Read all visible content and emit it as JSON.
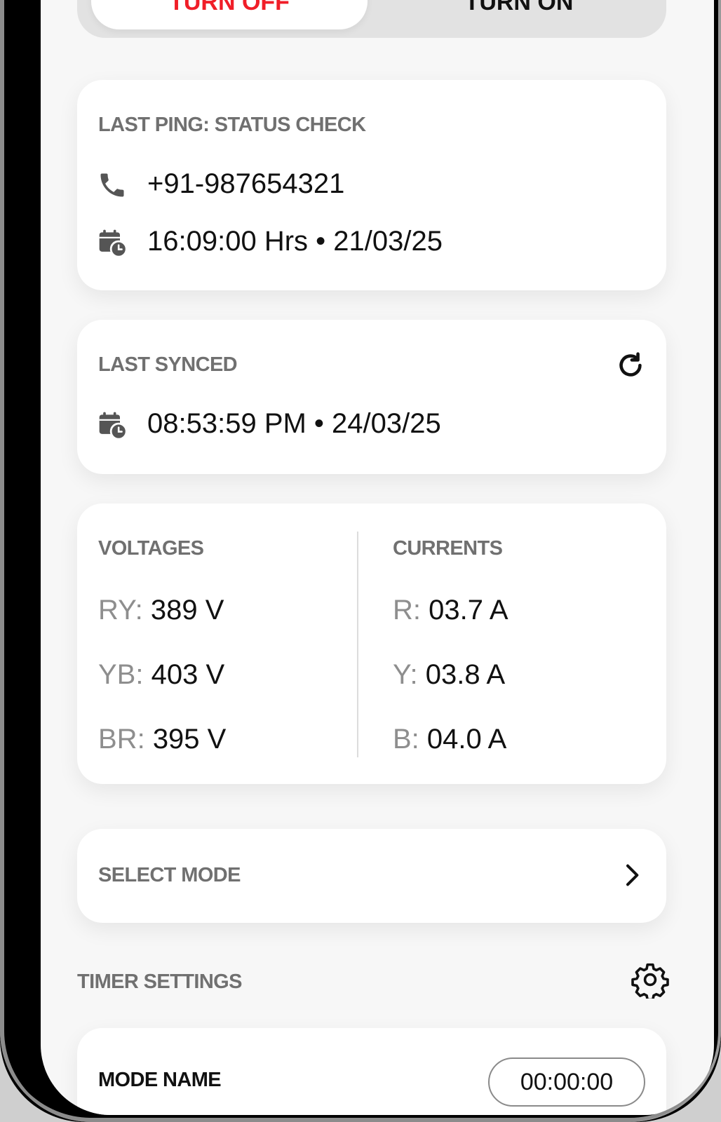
{
  "toggle": {
    "off_label": "TURN OFF",
    "on_label": "TURN ON"
  },
  "last_ping": {
    "title": "LAST PING: STATUS CHECK",
    "phone": "+91-987654321",
    "datetime": "16:09:00 Hrs • 21/03/25"
  },
  "last_synced": {
    "title": "LAST SYNCED",
    "datetime": "08:53:59 PM • 24/03/25"
  },
  "voltages": {
    "title": "VOLTAGES",
    "rows": [
      {
        "label": "RY:",
        "value": "389 V"
      },
      {
        "label": "YB:",
        "value": "403 V"
      },
      {
        "label": "BR:",
        "value": "395 V"
      }
    ]
  },
  "currents": {
    "title": "CURRENTS",
    "rows": [
      {
        "label": "R:",
        "value": "03.7 A"
      },
      {
        "label": "Y:",
        "value": "03.8 A"
      },
      {
        "label": "B:",
        "value": "04.0 A"
      }
    ]
  },
  "select_mode": {
    "label": "SELECT MODE"
  },
  "timer_settings": {
    "title": "TIMER SETTINGS"
  },
  "mode_card": {
    "mode_name": "MODE NAME",
    "timer_value": "00:00:00"
  },
  "colors": {
    "turn_off": "#f01e28",
    "label_gray": "#707070",
    "text": "#111111"
  },
  "icons": [
    "phone-icon",
    "calendar-clock-icon",
    "refresh-icon",
    "chevron-right-icon",
    "gear-icon"
  ]
}
